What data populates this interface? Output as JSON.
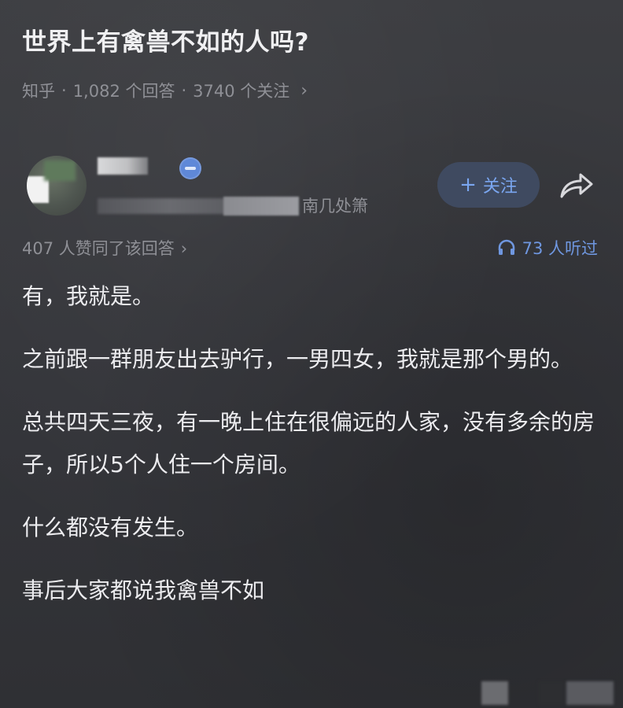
{
  "question": {
    "title": "世界上有禽兽不如的人吗?",
    "source": "知乎",
    "sep1": "·",
    "answers": "1,082 个回答",
    "sep2": "·",
    "followers": "3740 个关注",
    "chevron": "›"
  },
  "author": {
    "bio_tail": "南几处箫",
    "follow_plus": "+",
    "follow_label": "关注"
  },
  "stats": {
    "upvotes": "407 人赞同了该回答",
    "chevron": "›",
    "listens": "73 人听过"
  },
  "answer": {
    "paragraphs": [
      "有，我就是。",
      "之前跟一群朋友出去驴行，一男四女，我就是那个男的。",
      "总共四天三夜，有一晚上住在很偏远的人家，没有多余的房子，所以5个人住一个房间。",
      "什么都没有发生。",
      "事后大家都说我禽兽不如"
    ]
  },
  "colors": {
    "background": "#3a3b3f",
    "accent": "#7aa6f0",
    "muted": "#8f9096"
  },
  "icons": {
    "share": "share-icon",
    "headphones": "headphones-icon",
    "badge": "verified-badge-icon"
  }
}
